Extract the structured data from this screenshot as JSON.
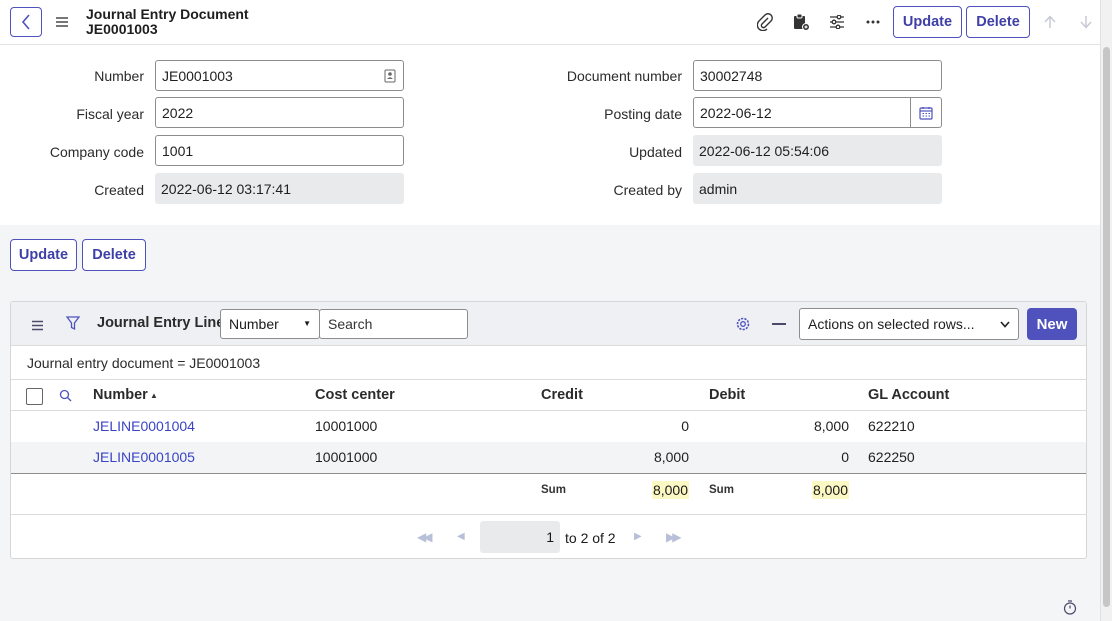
{
  "header": {
    "title": "Journal Entry Document",
    "subtitle": "JE0001003",
    "update_label": "Update",
    "delete_label": "Delete"
  },
  "form": {
    "number_label": "Number",
    "number_value": "JE0001003",
    "fiscal_year_label": "Fiscal year",
    "fiscal_year_value": "2022",
    "company_code_label": "Company code",
    "company_code_value": "1001",
    "created_label": "Created",
    "created_value": "2022-06-12 03:17:41",
    "document_number_label": "Document number",
    "document_number_value": "30002748",
    "posting_date_label": "Posting date",
    "posting_date_value": "2022-06-12",
    "updated_label": "Updated",
    "updated_value": "2022-06-12 05:54:06",
    "created_by_label": "Created by",
    "created_by_value": "admin"
  },
  "form_actions": {
    "update_label": "Update",
    "delete_label": "Delete"
  },
  "related_list": {
    "title": "Journal Entry Lines",
    "search_field_selected": "Number",
    "search_placeholder": "Search",
    "actions_selected": "Actions on selected rows...",
    "new_label": "New",
    "filter_text": "Journal entry document = JE0001003",
    "columns": [
      "Number",
      "Cost center",
      "Credit",
      "Debit",
      "GL Account"
    ],
    "rows": [
      {
        "number": "JELINE0001004",
        "cost_center": "10001000",
        "credit": "0",
        "debit": "8,000",
        "gl_account": "622210"
      },
      {
        "number": "JELINE0001005",
        "cost_center": "10001000",
        "credit": "8,000",
        "debit": "0",
        "gl_account": "622250"
      }
    ],
    "sum_label": "Sum",
    "credit_sum": "8,000",
    "debit_sum": "8,000",
    "pagination": {
      "current": "1",
      "range_text": "to 2 of 2"
    }
  },
  "colors": {
    "accent": "#4f52bd",
    "link": "#3a44c4",
    "sum_highlight": "#fbf8c4"
  },
  "icons": [
    "back-arrow-icon",
    "hamburger-icon",
    "paperclip-icon",
    "clipboard-icon",
    "sliders-icon",
    "more-icon",
    "arrow-up-icon",
    "arrow-down-icon",
    "contact-card-icon",
    "calendar-icon",
    "filter-icon",
    "search-icon",
    "gear-icon",
    "minus-icon",
    "sort-asc-icon",
    "first-page-icon",
    "prev-page-icon",
    "next-page-icon",
    "last-page-icon",
    "stopwatch-icon"
  ]
}
